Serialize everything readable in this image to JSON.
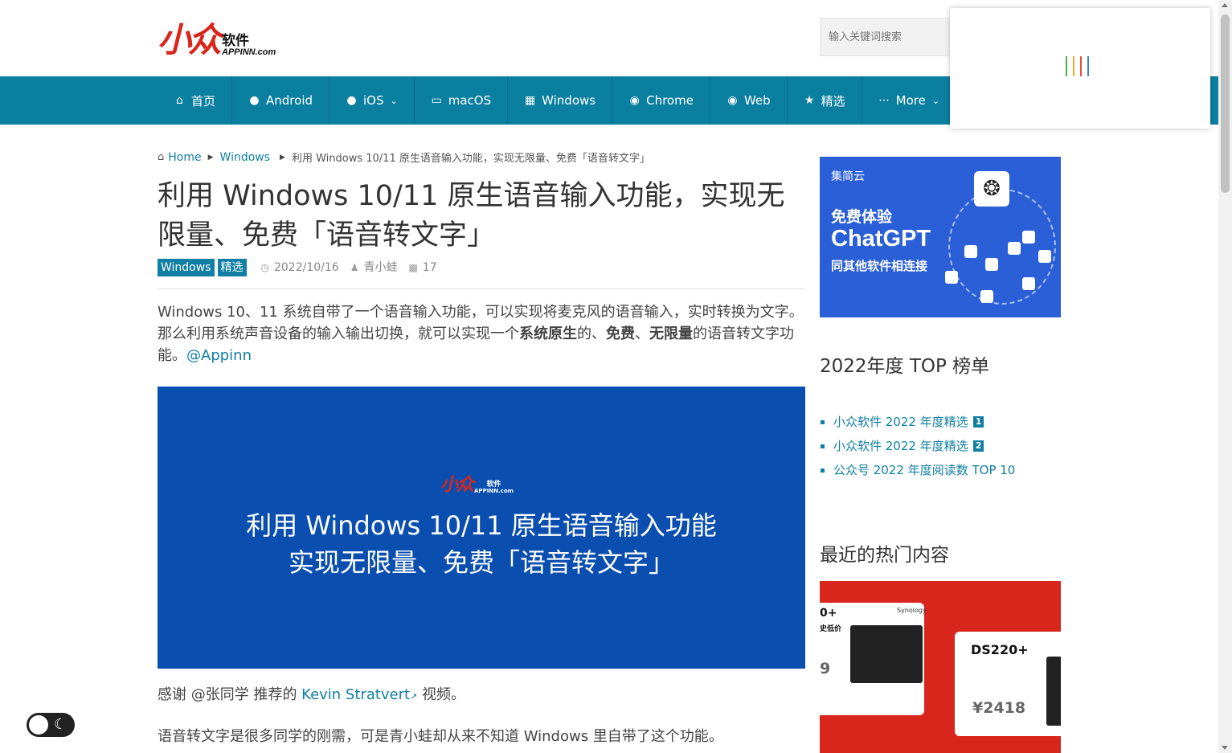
{
  "header": {
    "logo_text": "小众",
    "logo_cn": "软件",
    "logo_en": "APPINN.com",
    "search_placeholder": "输入关键词搜索"
  },
  "nav": {
    "items": [
      {
        "label": "首页",
        "icon": "home-icon"
      },
      {
        "label": "Android",
        "icon": "android-icon"
      },
      {
        "label": "iOS",
        "icon": "apple-icon",
        "dropdown": true
      },
      {
        "label": "macOS",
        "icon": "monitor-icon"
      },
      {
        "label": "Windows",
        "icon": "windows-icon"
      },
      {
        "label": "Chrome",
        "icon": "chrome-icon"
      },
      {
        "label": "Web",
        "icon": "globe-icon"
      },
      {
        "label": "精选",
        "icon": "star-icon"
      },
      {
        "label": "More",
        "icon": "dots-icon",
        "dropdown": true
      }
    ]
  },
  "breadcrumb": {
    "home": "Home",
    "category": "Windows",
    "current": "利用 Windows 10/11 原生语音输入功能，实现无限量、免费「语音转文字」"
  },
  "article": {
    "title": "利用 Windows 10/11 原生语音输入功能，实现无限量、免费「语音转文字」",
    "tags": [
      "Windows",
      "精选"
    ],
    "date": "2022/10/16",
    "author": "青小蛙",
    "comments": "17",
    "intro_1": "Windows 10、11 系统自带了一个语音输入功能，可以实现将麦克风的语音输入，实时转换为文字。那么利用系统声音设备的输入输出切换，就可以实现一个",
    "intro_b1": "系统原生",
    "intro_2": "的、",
    "intro_b2": "免费",
    "intro_3": "、",
    "intro_b3": "无限量",
    "intro_4": "的语音转文字功能。",
    "intro_link": "@Appinn",
    "hero_logo": "小众",
    "hero_logo_cn": "软件",
    "hero_logo_en": "APPINN.com",
    "hero_line1": "利用 Windows 10/11 原生语音输入功能",
    "hero_line2": "实现无限量、免费「语音转文字」",
    "p2_before": "感谢 @张同学 推荐的 ",
    "p2_link": "Kevin Stratvert",
    "p2_after": " 视频。",
    "p3": "语音转文字是很多同学的刚需，可是青小蛙却从来不知道 Windows 里自带了这个功能。"
  },
  "sidebar": {
    "ad": {
      "brand": "集简云",
      "line1": "免费体验",
      "line2": "ChatGPT",
      "line3": "同其他软件相连接"
    },
    "top_title": "2022年度 TOP 榜单",
    "top_items": [
      {
        "label": "小众软件 2022 年度精选",
        "badge": "1"
      },
      {
        "label": "小众软件 2022 年度精选",
        "badge": "2"
      },
      {
        "label": "公众号 2022 年度阅读数 TOP 10",
        "badge": ""
      }
    ],
    "hot_title": "最近的热门内容",
    "hot_card": {
      "left_title": "0+",
      "left_sub": "史低价",
      "left_price": "9",
      "brand": "Synology",
      "model": "DS220+",
      "price": "¥2418"
    }
  },
  "colors": {
    "nav_bg": "#0b7fa0",
    "link": "#0f7fa3",
    "logo_red": "#d9261c",
    "hero_bg": "#0a4fb0"
  }
}
